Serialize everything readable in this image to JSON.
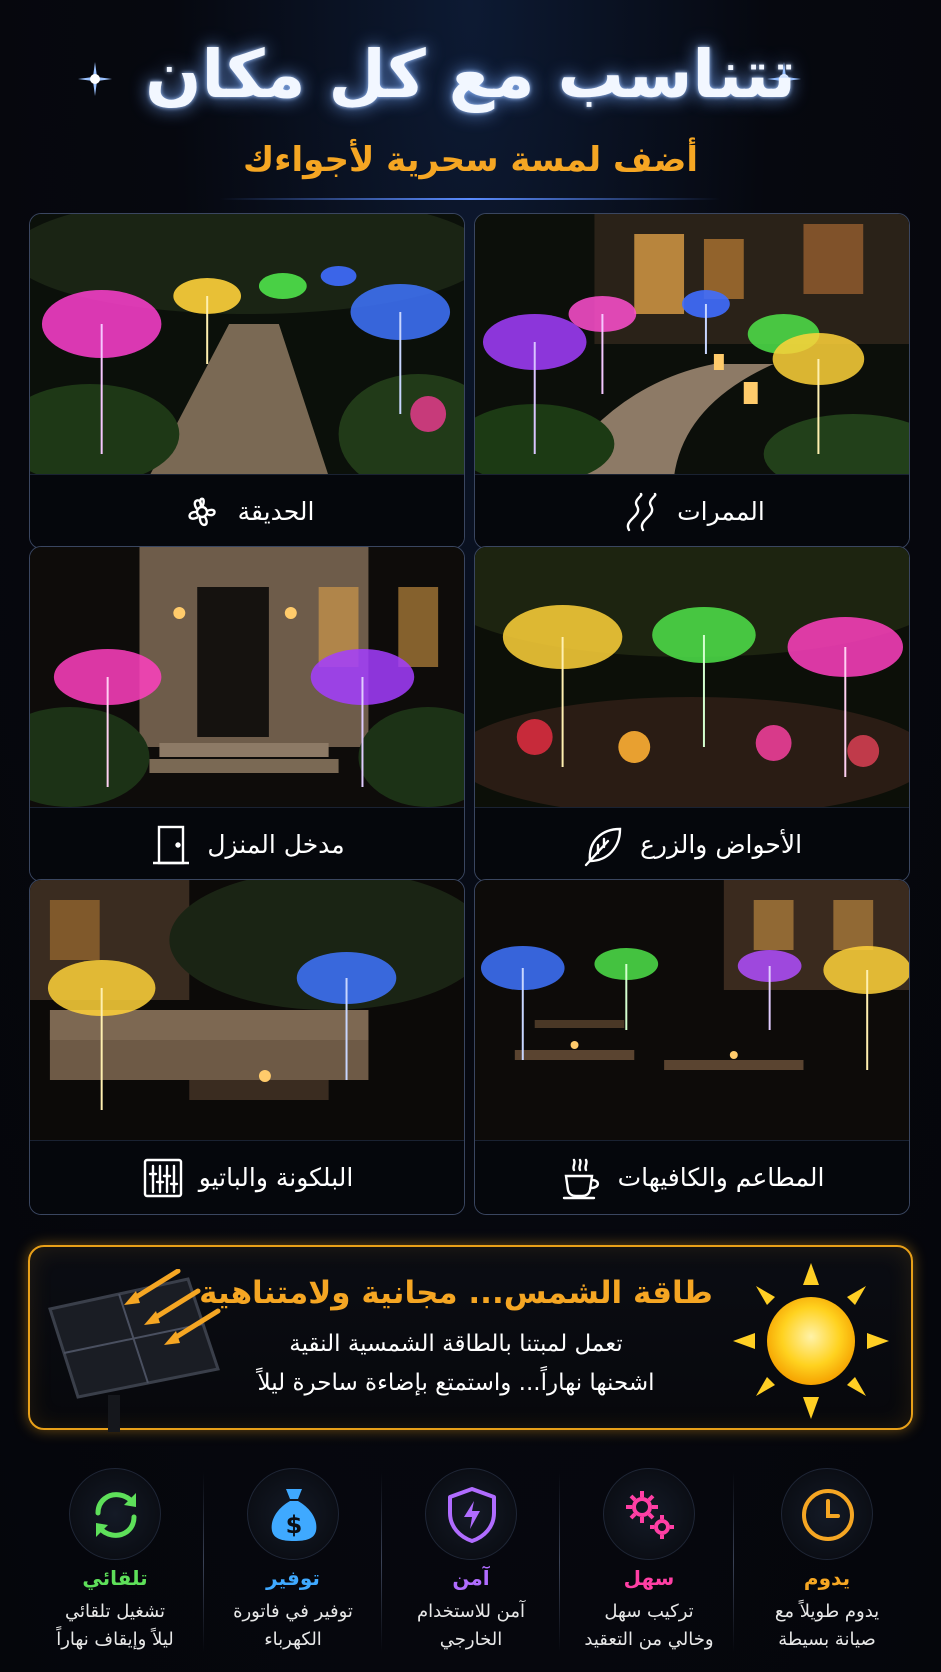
{
  "header": {
    "title": "تتناسب مع كل مكان",
    "subtitle": "أضف لمسة سحرية لأجواءك"
  },
  "cards": [
    {
      "label": "الممرات",
      "icon": "winding-path-icon"
    },
    {
      "label": "الحديقة",
      "icon": "flower-icon"
    },
    {
      "label": "الأحواض والزرع",
      "icon": "leaf-icon"
    },
    {
      "label": "مدخل المنزل",
      "icon": "door-icon"
    },
    {
      "label": "المطاعم والكافيهات",
      "icon": "coffee-cup-icon"
    },
    {
      "label": "البلكونة والباتيو",
      "icon": "balcony-railing-icon"
    }
  ],
  "solar": {
    "title": "طاقة الشمس... مجانية ولامتناهية",
    "line1": "تعمل لمبتنا بالطاقة الشمسية النقية",
    "line2": "اشحنها نهاراً... واستمتع بإضاءة ساحرة ليلاً"
  },
  "features": [
    {
      "name": "يدوم",
      "desc1": "يدوم طويلاً مع",
      "desc2": "صيانة بسيطة",
      "color": "#f5a623",
      "icon": "clock-icon"
    },
    {
      "name": "سهل",
      "desc1": "تركيب سهل",
      "desc2": "وخالي من التعقيد",
      "color": "#ff3fa4",
      "icon": "gears-icon"
    },
    {
      "name": "آمن",
      "desc1": "آمن للاستخدام",
      "desc2": "الخارجي",
      "color": "#b06cff",
      "icon": "shield-icon"
    },
    {
      "name": "توفير",
      "desc1": "توفير في فاتورة",
      "desc2": "الكهرباء",
      "color": "#3fa9ff",
      "icon": "money-bag-icon"
    },
    {
      "name": "تلقائي",
      "desc1": "تشغيل تلقائي",
      "desc2": "ليلاً وإيقاف نهاراً",
      "color": "#5ee05a",
      "icon": "auto-cycle-icon"
    }
  ]
}
